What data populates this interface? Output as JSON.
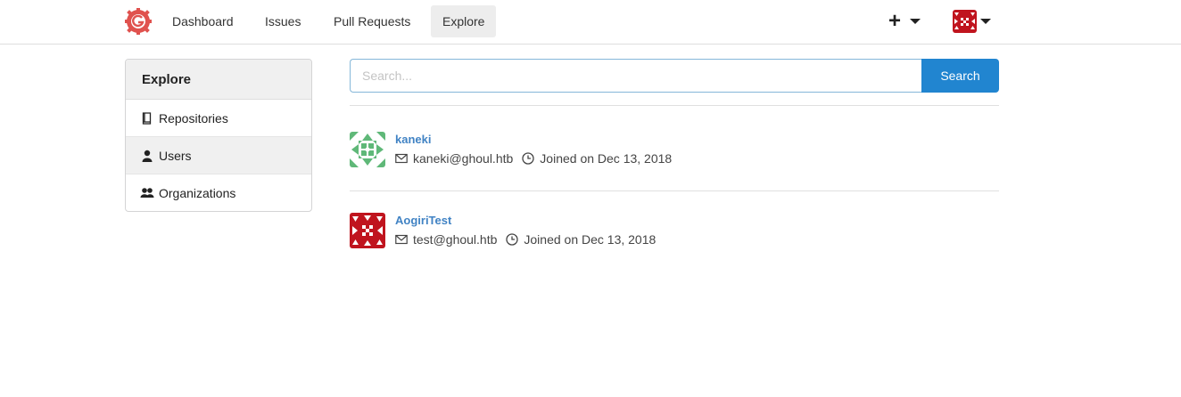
{
  "nav": {
    "logo_icon": "gitea-logo-icon",
    "items": [
      {
        "label": "Dashboard",
        "active": false
      },
      {
        "label": "Issues",
        "active": false
      },
      {
        "label": "Pull Requests",
        "active": false
      },
      {
        "label": "Explore",
        "active": true
      }
    ],
    "create_icon": "plus-icon",
    "accent": "#e0524e"
  },
  "sidebar": {
    "header": "Explore",
    "items": [
      {
        "label": "Repositories",
        "icon": "book-icon",
        "active": false
      },
      {
        "label": "Users",
        "icon": "person-icon",
        "active": true
      },
      {
        "label": "Organizations",
        "icon": "organization-icon",
        "active": false
      }
    ]
  },
  "search": {
    "placeholder": "Search...",
    "value": "",
    "button_label": "Search",
    "button_color": "#2185d0"
  },
  "users": [
    {
      "name": "kaneki",
      "email": "kaneki@ghoul.htb",
      "joined": "Joined on Dec 13, 2018",
      "avatar_color": "#5fb878"
    },
    {
      "name": "AogiriTest",
      "email": "test@ghoul.htb",
      "joined": "Joined on Dec 13, 2018",
      "avatar_color": "#c0141e"
    }
  ],
  "colors": {
    "link": "#4183c4",
    "active_bg": "#ededed"
  }
}
